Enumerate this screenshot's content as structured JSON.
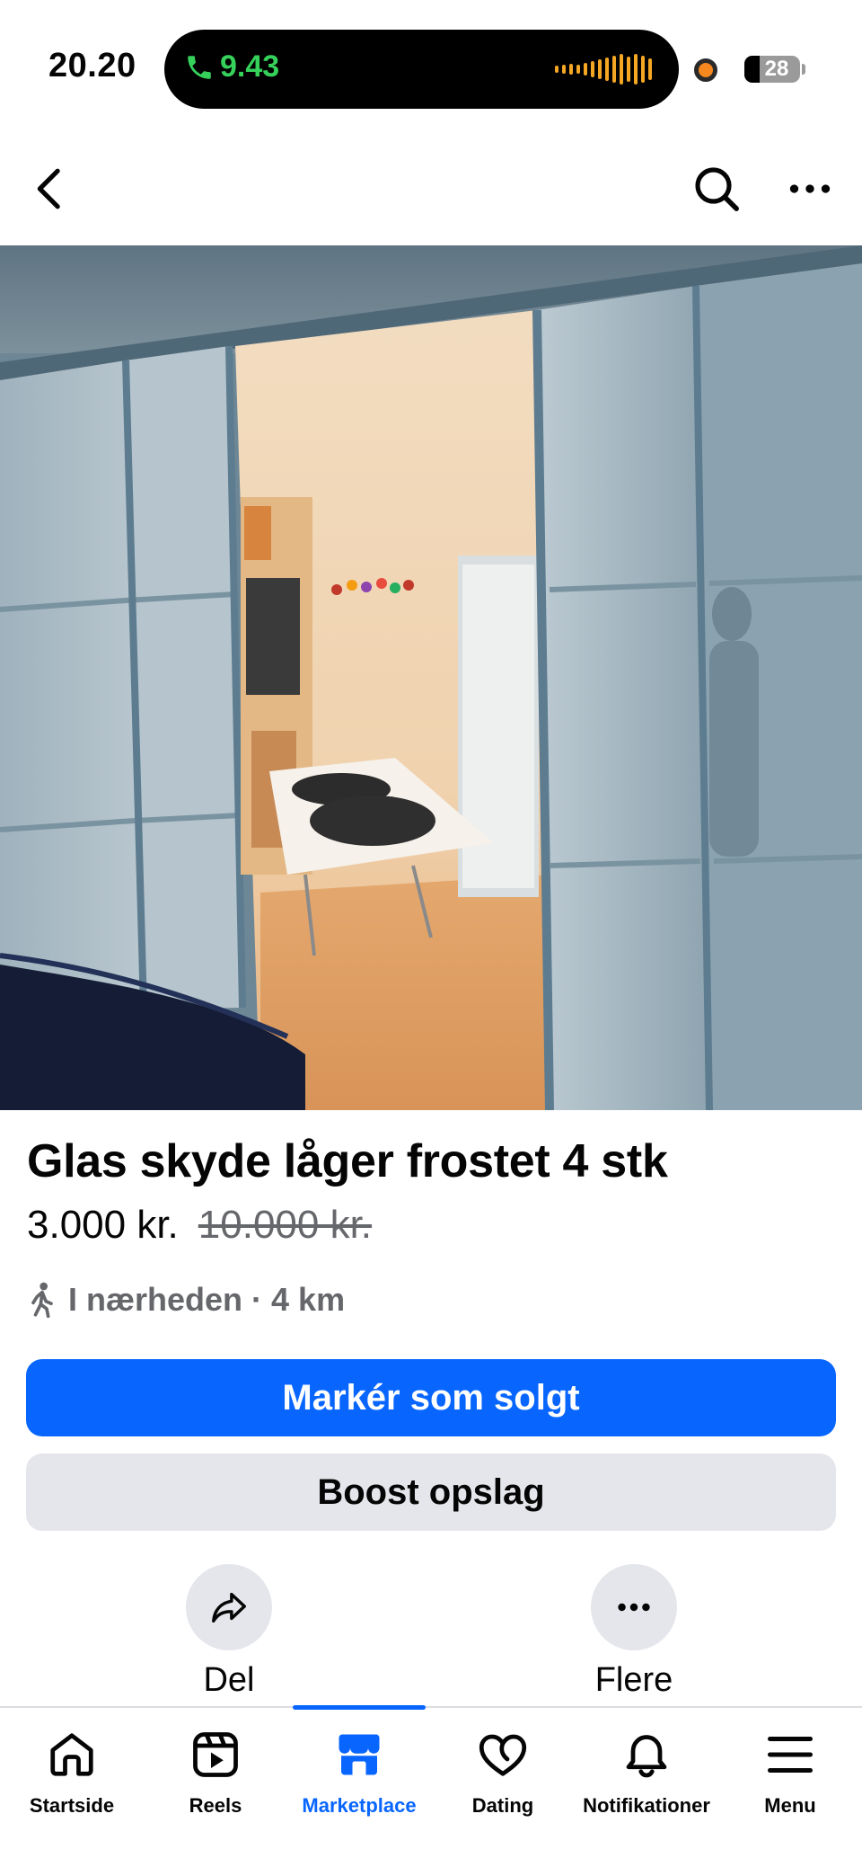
{
  "status_bar": {
    "time": "20.20",
    "call_time": "9.43",
    "battery": "28",
    "battery_level_percent": 28
  },
  "colors": {
    "accent": "#0866ff",
    "call_green": "#36d15a",
    "secondary_button": "#e4e6eb",
    "muted_text": "#65676b"
  },
  "top_nav": {
    "back_icon": "chevron-left-icon",
    "search_icon": "search-icon",
    "more_icon": "more-horizontal-icon"
  },
  "listing": {
    "image_icon": "photo-glass-sliding-doors",
    "title": "Glas skyde låger frostet 4 stk",
    "price": "3.000 kr.",
    "original_price": "10.000 kr.",
    "location": "I nærheden · 4 km",
    "location_icon": "walking-person-icon"
  },
  "buttons": {
    "mark_sold": "Markér som solgt",
    "boost": "Boost opslag"
  },
  "actions": [
    {
      "label": "Del",
      "icon": "share-icon"
    },
    {
      "label": "Flere",
      "icon": "more-horizontal-icon"
    }
  ],
  "tabs": [
    {
      "label": "Startside",
      "icon": "home-icon",
      "active": false
    },
    {
      "label": "Reels",
      "icon": "reels-icon",
      "active": false
    },
    {
      "label": "Marketplace",
      "icon": "marketplace-icon",
      "active": true
    },
    {
      "label": "Dating",
      "icon": "dating-heart-icon",
      "active": false
    },
    {
      "label": "Notifikationer",
      "icon": "bell-icon",
      "active": false
    },
    {
      "label": "Menu",
      "icon": "menu-icon",
      "active": false
    }
  ]
}
